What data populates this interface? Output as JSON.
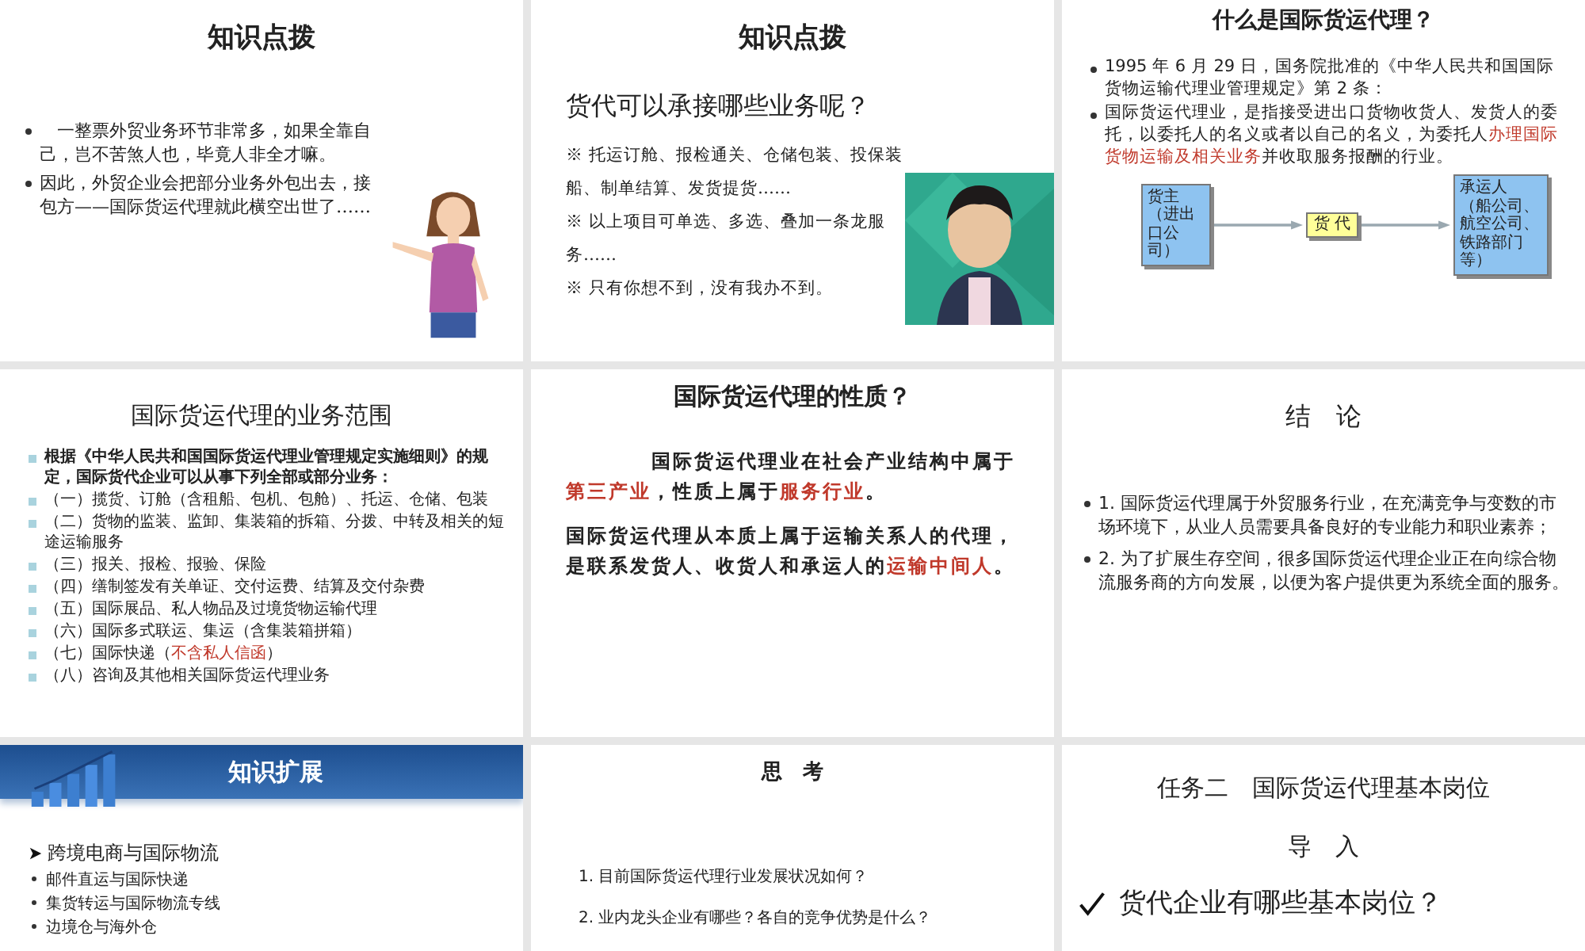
{
  "slides": [
    {
      "kind": "intro",
      "title": "知识点拨",
      "bullets": [
        "　一整票外贸业务环节非常多，如果全靠自己，岂不苦煞人也，毕竟人非全才嘛。",
        "因此，外贸企业会把部分业务外包出去，接包方——国际货运代理就此横空出世了……"
      ]
    },
    {
      "kind": "services",
      "title": "知识点拨",
      "question": "货代可以承接哪些业务呢？",
      "lines": [
        "※ 托运订舱、报检通关、仓储包装、投保装船、制单结算、发货提货……",
        "※ 以上项目可单选、多选、叠加一条龙服务……",
        "※ 只有你想不到，没有我办不到。"
      ]
    },
    {
      "kind": "definition",
      "title": "什么是国际货运代理？",
      "bullets": [
        [
          {
            "text": "1995 年 6 月 29 日，国务院批准的《中华人民共和国国际货物运输代理业管理规定》第 2 条：",
            "highlight": false
          }
        ],
        [
          {
            "text": "国际货运代理业，是指接受进出口货物收货人、发货人的委托，以委托人的名义或者以自己的名义，为委托人",
            "highlight": false
          },
          {
            "text": "办理国际货物运输及相关业务",
            "highlight": true
          },
          {
            "text": "并收取服务报酬的行业。",
            "highlight": false
          }
        ]
      ],
      "diagram": {
        "shipper": [
          "货主",
          "（进出口公司）"
        ],
        "agent": "货 代",
        "carrier": [
          "承运人",
          "（船公司、航空公司、铁路部门等）"
        ]
      }
    },
    {
      "kind": "scope",
      "title": "国际货运代理的业务范围",
      "items": [
        [
          {
            "text": "根据《中华人民共和国国际货运代理业管理规定实施细则》的规定，国际货代企业可以从事下列全部或部分业务：",
            "highlight": false,
            "bold": true
          }
        ],
        [
          {
            "text": "（一）揽货、订舱（含租船、包机、包舱）、托运、仓储、包装",
            "highlight": false,
            "bold": false
          }
        ],
        [
          {
            "text": "（二）货物的监装、监卸、集装箱的拆箱、分拨、中转及相关的短途运输服务",
            "highlight": false,
            "bold": false
          }
        ],
        [
          {
            "text": "（三）报关、报检、报验、保险",
            "highlight": false,
            "bold": false
          }
        ],
        [
          {
            "text": "（四）缮制签发有关单证、交付运费、结算及交付杂费",
            "highlight": false,
            "bold": false
          }
        ],
        [
          {
            "text": "（五）国际展品、私人物品及过境货物运输代理",
            "highlight": false,
            "bold": false
          }
        ],
        [
          {
            "text": "（六）国际多式联运、集运（含集装箱拼箱）",
            "highlight": false,
            "bold": false
          }
        ],
        [
          {
            "text": "（七）国际快递（",
            "highlight": false,
            "bold": false
          },
          {
            "text": "不含私人信函",
            "highlight": true,
            "bold": false
          },
          {
            "text": "）",
            "highlight": false,
            "bold": false
          }
        ],
        [
          {
            "text": "（八）咨询及其他相关国际货运代理业务",
            "highlight": false,
            "bold": false
          }
        ]
      ]
    },
    {
      "kind": "nature",
      "title": "国际货运代理的性质？",
      "paragraphs": [
        [
          {
            "text": "国际货运代理业在社会产业结构中属于",
            "highlight": false
          },
          {
            "text": "第三产业",
            "highlight": true
          },
          {
            "text": "，性质上属于",
            "highlight": false
          },
          {
            "text": "服务行业",
            "highlight": true
          },
          {
            "text": "。",
            "highlight": false
          }
        ],
        [
          {
            "text": "国际货运代理从本质上属于运输关系人的代理，是联系发货人、收货人和承运人的",
            "highlight": false
          },
          {
            "text": "运输中间人",
            "highlight": true
          },
          {
            "text": "。",
            "highlight": false
          }
        ]
      ]
    },
    {
      "kind": "conclusion",
      "title": "结　论",
      "bullets": [
        "1. 国际货运代理属于外贸服务行业，在充满竞争与变数的市场环境下，从业人员需要具备良好的专业能力和职业素养；",
        "2. 为了扩展生存空间，很多国际货运代理企业正在向综合物流服务商的方向发展，以便为客户提供更为系统全面的服务。"
      ]
    },
    {
      "kind": "banner",
      "title": "知识扩展",
      "heading": "跨境电商与国际物流",
      "bullets": [
        "邮件直运与国际快递",
        "集货转运与国际物流专线",
        "边境仓与海外仓"
      ]
    },
    {
      "kind": "questions",
      "title": "思　考",
      "questions": [
        "1. 目前国际货运代理行业发展状况如何？",
        "2. 业内龙头企业有哪些？各自的竞争优势是什么？"
      ]
    },
    {
      "kind": "task",
      "title": "任务二　国际货运代理基本岗位",
      "subtitle": "导　入",
      "question": "货代企业有哪些基本岗位？"
    }
  ]
}
